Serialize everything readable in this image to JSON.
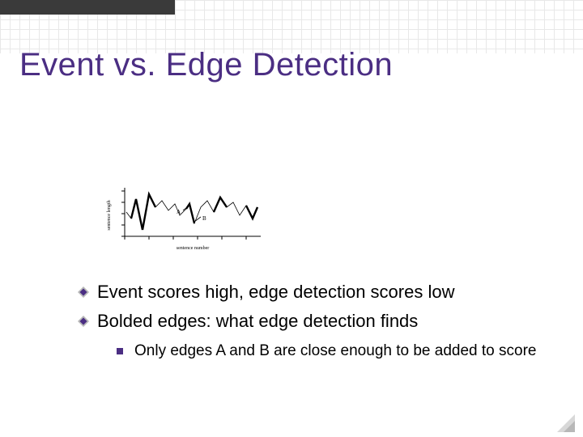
{
  "title": "Event vs. Edge Detection",
  "bullets": {
    "b1": "Event scores high, edge detection scores low",
    "b2": "Bolded edges: what edge detection finds",
    "sub1": "Only edges A and B are close enough to be added to score"
  },
  "chart": {
    "ylabel": "sentence length",
    "xlabel": "sentence number",
    "labelA": "A",
    "labelB": "B"
  }
}
